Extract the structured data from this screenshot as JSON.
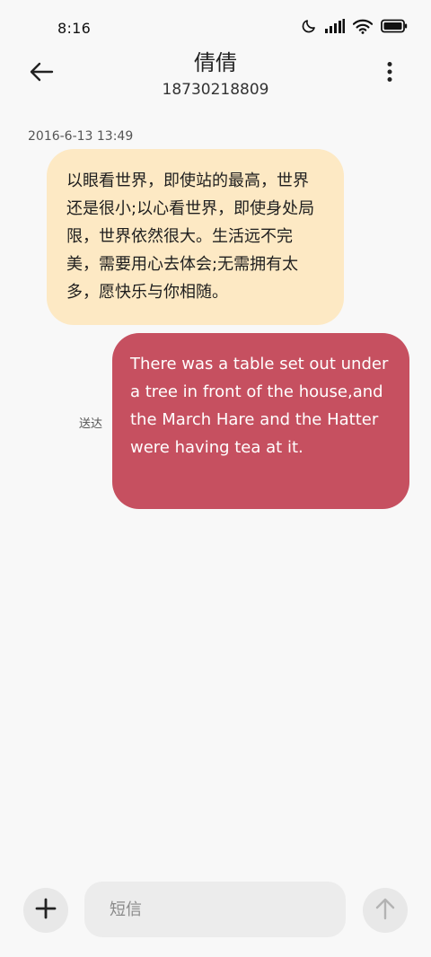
{
  "status_bar": {
    "time": "8:16",
    "icons": [
      "moon-icon",
      "signal-icon",
      "wifi-icon",
      "battery-icon"
    ]
  },
  "header": {
    "contact_name": "倩倩",
    "contact_number": "18730218809",
    "back_icon": "arrow-left-icon",
    "more_icon": "more-vertical-icon"
  },
  "conversation": {
    "timestamp": "2016-6-13 13:49",
    "messages": [
      {
        "direction": "incoming",
        "text": "以眼看世界，即使站的最高，世界还是很小;以心看世界，即使身处局限，世界依然很大。生活远不完美，需要用心去体会;无需拥有太多，愿快乐与你相随。"
      },
      {
        "direction": "outgoing",
        "text": "There was a table set out under a tree in front of the house,and the March Hare and the Hatter were having tea at it.",
        "status": "送达"
      }
    ]
  },
  "composer": {
    "placeholder": "短信",
    "value": "",
    "add_icon": "plus-icon",
    "send_icon": "arrow-up-icon"
  },
  "colors": {
    "incoming_bubble": "#fde9c4",
    "outgoing_bubble": "#c65060",
    "background": "#f8f8f8"
  }
}
